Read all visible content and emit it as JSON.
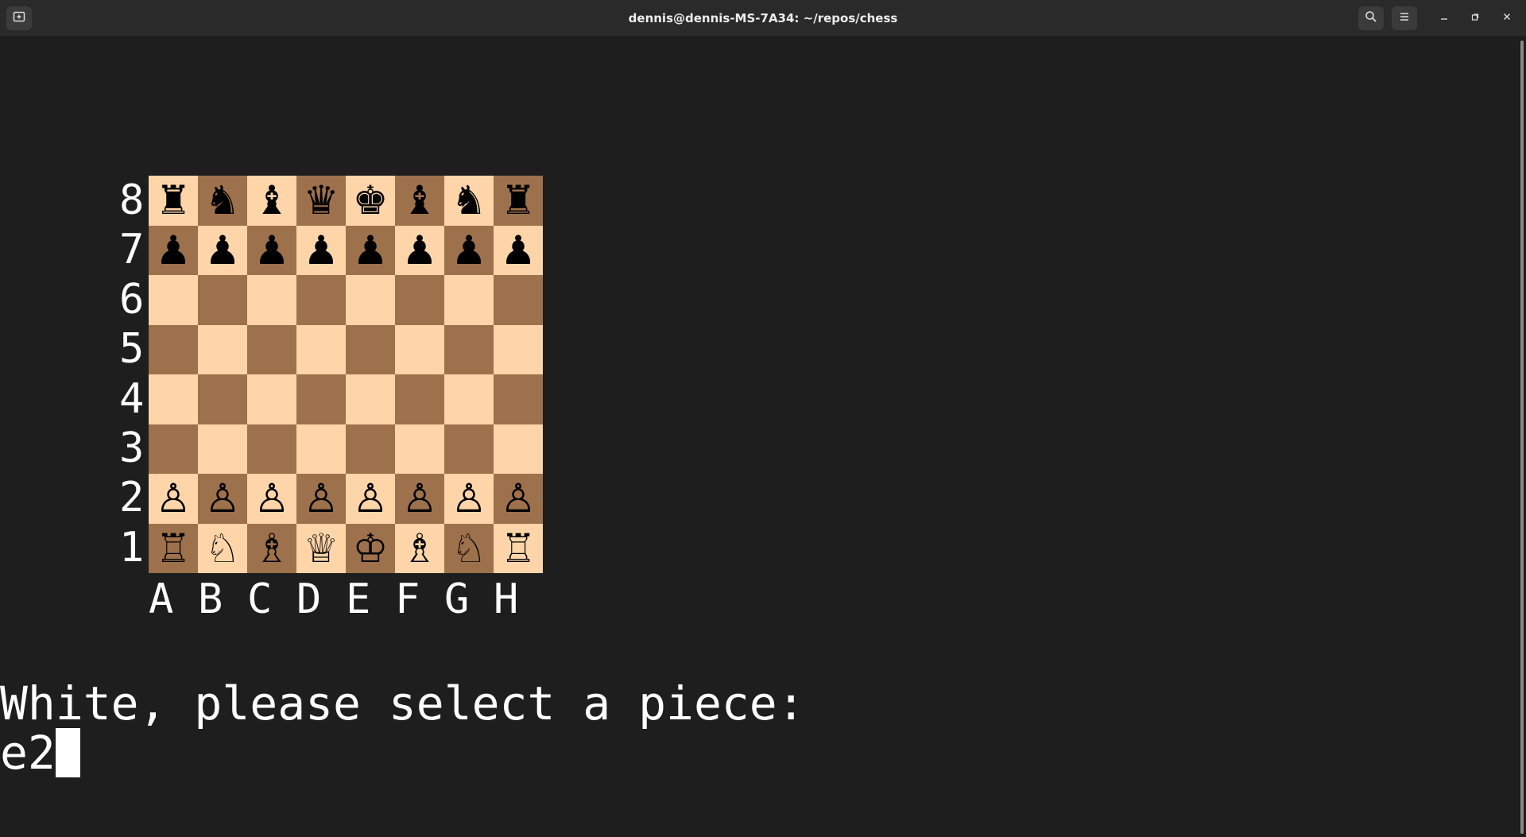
{
  "window": {
    "title": "dennis@dennis-MS-7A34: ~/repos/chess",
    "buttons": {
      "new_tab_icon": "new-tab-icon",
      "search_icon": "search-icon",
      "menu_icon": "hamburger-menu-icon",
      "minimize_icon": "minimize-icon",
      "maximize_icon": "restore-icon",
      "close_icon": "close-icon"
    }
  },
  "board": {
    "rank_labels": [
      "8",
      "7",
      "6",
      "5",
      "4",
      "3",
      "2",
      "1"
    ],
    "file_labels": [
      "A",
      "B",
      "C",
      "D",
      "E",
      "F",
      "G",
      "H"
    ],
    "light_square_color": "#fed5a9",
    "dark_square_color": "#9d714b",
    "rows": [
      [
        "♜",
        "♞",
        "♝",
        "♛",
        "♚",
        "♝",
        "♞",
        "♜"
      ],
      [
        "♟",
        "♟",
        "♟",
        "♟",
        "♟",
        "♟",
        "♟",
        "♟"
      ],
      [
        "",
        "",
        "",
        "",
        "",
        "",
        "",
        ""
      ],
      [
        "",
        "",
        "",
        "",
        "",
        "",
        "",
        ""
      ],
      [
        "",
        "",
        "",
        "",
        "",
        "",
        "",
        ""
      ],
      [
        "",
        "",
        "",
        "",
        "",
        "",
        "",
        ""
      ],
      [
        "♙",
        "♙",
        "♙",
        "♙",
        "♙",
        "♙",
        "♙",
        "♙"
      ],
      [
        "♖",
        "♘",
        "♗",
        "♕",
        "♔",
        "♗",
        "♘",
        "♖"
      ]
    ]
  },
  "terminal": {
    "prompt": "White, please select a piece:",
    "input_value": "e2"
  }
}
